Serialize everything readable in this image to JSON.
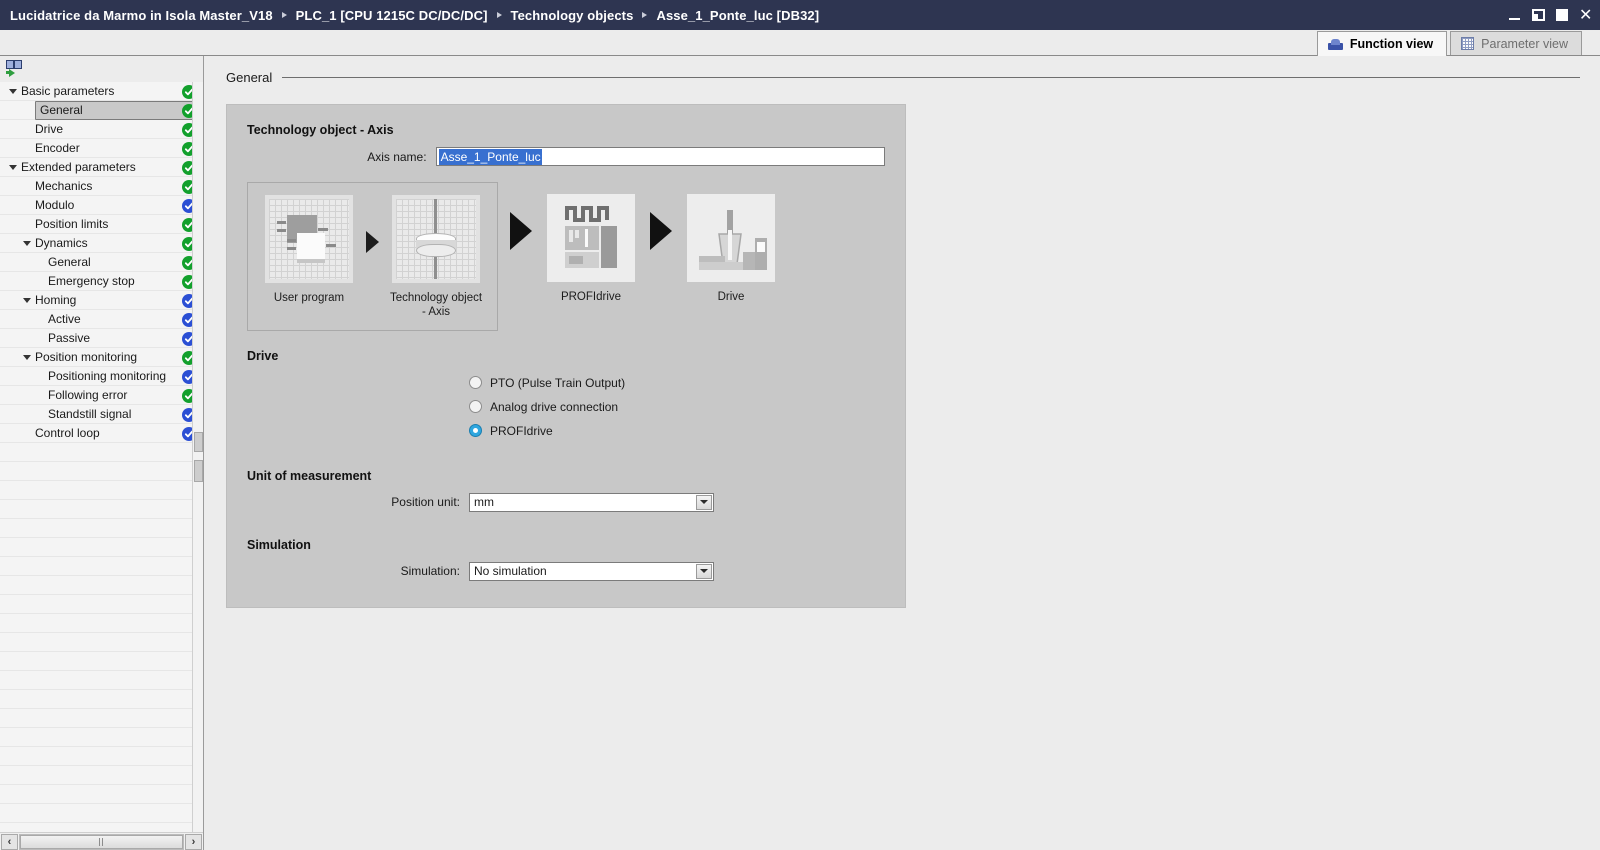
{
  "titlebar": {
    "breadcrumb": [
      "Lucidatrice da Marmo in Isola Master_V18",
      "PLC_1 [CPU 1215C DC/DC/DC]",
      "Technology objects",
      "Asse_1_Ponte_luc [DB32]"
    ],
    "window_controls": [
      "minimize",
      "restore",
      "maximize",
      "close"
    ],
    "bg_color": "#2e3551"
  },
  "tabs": [
    {
      "label": "Function view",
      "icon": "function-view-icon",
      "active": true
    },
    {
      "label": "Parameter view",
      "icon": "parameter-view-icon",
      "active": false
    }
  ],
  "nav": {
    "toolbar_icon": "compare-navigate-icon",
    "items": [
      {
        "label": "Basic parameters",
        "indent": 0,
        "twisty": "open",
        "status": "green",
        "selected": false
      },
      {
        "label": "General",
        "indent": 1,
        "twisty": "none",
        "status": "green",
        "selected": true
      },
      {
        "label": "Drive",
        "indent": 1,
        "twisty": "none",
        "status": "green",
        "selected": false
      },
      {
        "label": "Encoder",
        "indent": 1,
        "twisty": "none",
        "status": "green",
        "selected": false
      },
      {
        "label": "Extended parameters",
        "indent": 0,
        "twisty": "open",
        "status": "green",
        "selected": false
      },
      {
        "label": "Mechanics",
        "indent": 1,
        "twisty": "none",
        "status": "green",
        "selected": false
      },
      {
        "label": "Modulo",
        "indent": 1,
        "twisty": "none",
        "status": "blue",
        "selected": false
      },
      {
        "label": "Position limits",
        "indent": 1,
        "twisty": "none",
        "status": "green",
        "selected": false
      },
      {
        "label": "Dynamics",
        "indent": 1,
        "twisty": "open",
        "status": "green",
        "selected": false
      },
      {
        "label": "General",
        "indent": 2,
        "twisty": "none",
        "status": "green",
        "selected": false
      },
      {
        "label": "Emergency stop",
        "indent": 2,
        "twisty": "none",
        "status": "green",
        "selected": false
      },
      {
        "label": "Homing",
        "indent": 1,
        "twisty": "open",
        "status": "blue",
        "selected": false
      },
      {
        "label": "Active",
        "indent": 2,
        "twisty": "none",
        "status": "blue",
        "selected": false
      },
      {
        "label": "Passive",
        "indent": 2,
        "twisty": "none",
        "status": "blue",
        "selected": false
      },
      {
        "label": "Position monitoring",
        "indent": 1,
        "twisty": "open",
        "status": "green",
        "selected": false
      },
      {
        "label": "Positioning monitoring",
        "indent": 2,
        "twisty": "none",
        "status": "blue",
        "selected": false
      },
      {
        "label": "Following error",
        "indent": 2,
        "twisty": "none",
        "status": "green",
        "selected": false
      },
      {
        "label": "Standstill signal",
        "indent": 2,
        "twisty": "none",
        "status": "blue",
        "selected": false
      },
      {
        "label": "Control loop",
        "indent": 1,
        "twisty": "none",
        "status": "blue",
        "selected": false
      }
    ],
    "status_colors": {
      "green": "#12a02c",
      "blue": "#2b4fd4"
    },
    "hscroll": {
      "left_arrow": "‹",
      "right_arrow": "›"
    }
  },
  "content": {
    "section_title": "General",
    "group_title": "Technology object - Axis",
    "axis_name": {
      "label": "Axis name:",
      "value": "Asse_1_Ponte_luc",
      "selected": true
    },
    "diagram": {
      "stages": [
        {
          "label": "User program",
          "icon": "user-program-icon"
        },
        {
          "label": "Technology object - Axis",
          "icon": "technology-object-axis-icon"
        },
        {
          "label": "PROFIdrive",
          "icon": "profidrive-icon"
        },
        {
          "label": "Drive",
          "icon": "drive-icon"
        }
      ]
    },
    "drive": {
      "title": "Drive",
      "options": [
        {
          "label": "PTO (Pulse Train Output)",
          "checked": false
        },
        {
          "label": "Analog drive connection",
          "checked": false
        },
        {
          "label": "PROFIdrive",
          "checked": true
        }
      ],
      "accent_color": "#2ea6df"
    },
    "unit_of_measurement": {
      "title": "Unit of measurement",
      "field_label": "Position unit:",
      "value": "mm"
    },
    "simulation": {
      "title": "Simulation",
      "field_label": "Simulation:",
      "value": "No simulation"
    }
  }
}
